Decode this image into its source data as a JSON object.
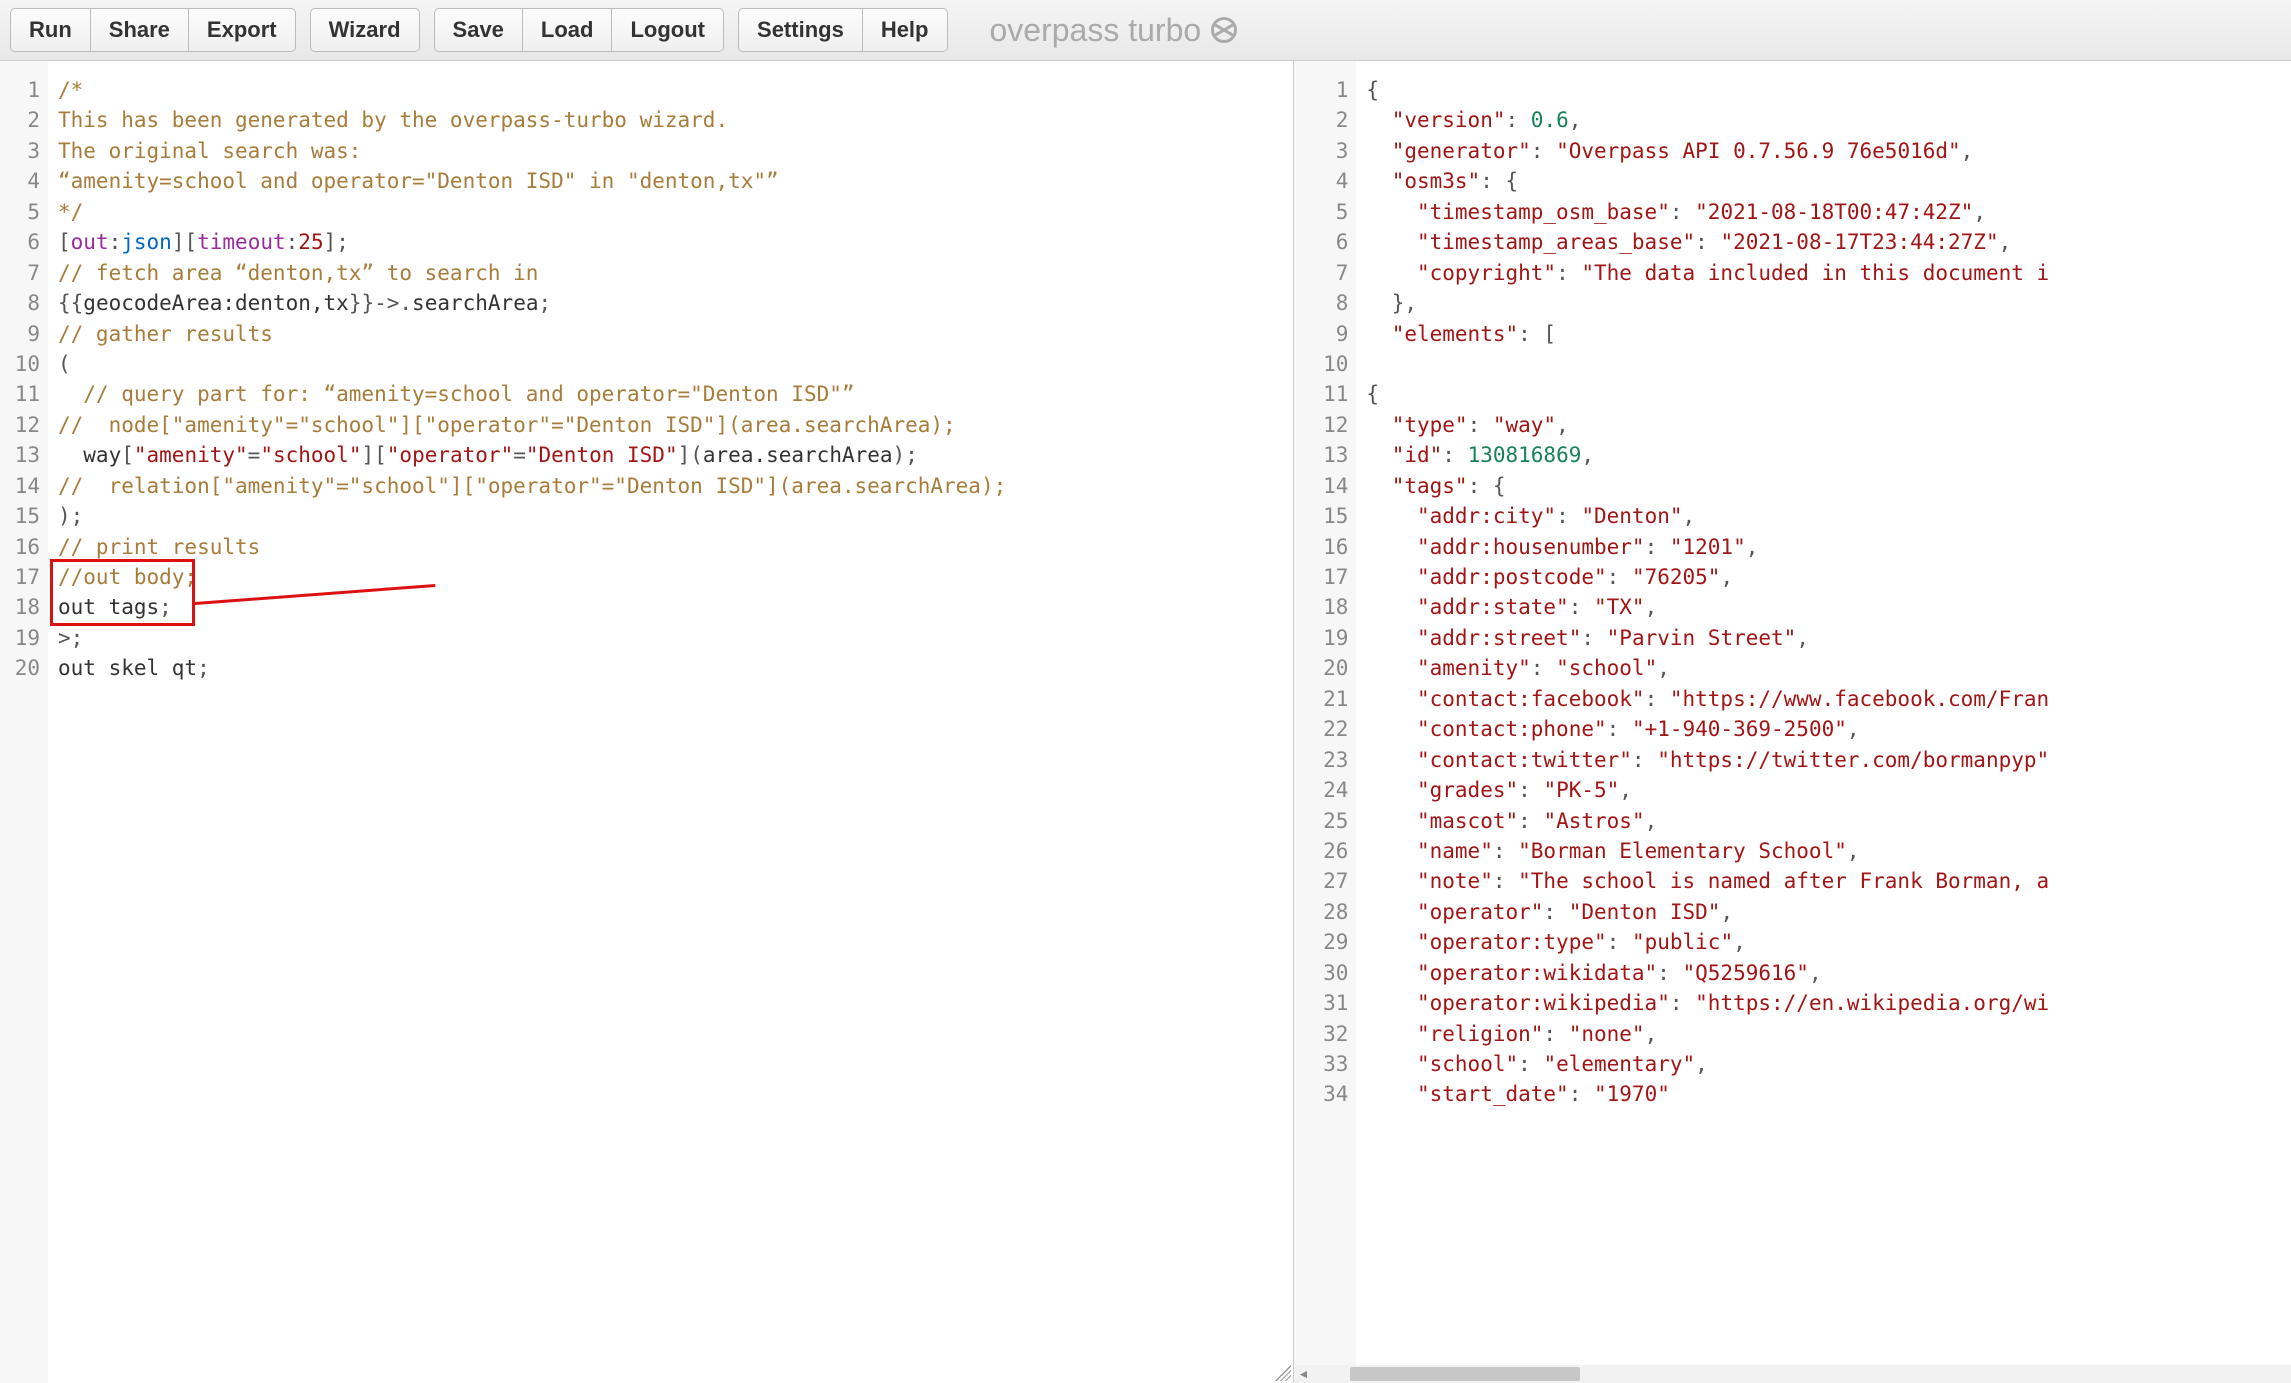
{
  "toolbar": {
    "groups": [
      [
        "Run",
        "Share",
        "Export"
      ],
      [
        "Wizard"
      ],
      [
        "Save",
        "Load",
        "Logout"
      ],
      [
        "Settings",
        "Help"
      ]
    ]
  },
  "brand": {
    "text": "overpass turbo"
  },
  "left_editor": {
    "lines": [
      [
        {
          "cls": "tok-comment",
          "t": "/*"
        }
      ],
      [
        {
          "cls": "tok-comment",
          "t": "This has been generated by the overpass-turbo wizard."
        }
      ],
      [
        {
          "cls": "tok-comment",
          "t": "The original search was:"
        }
      ],
      [
        {
          "cls": "tok-comment",
          "t": "“amenity=school and operator=\"Denton ISD\" in \"denton,tx\"”"
        }
      ],
      [
        {
          "cls": "tok-comment",
          "t": "*/"
        }
      ],
      [
        {
          "cls": "tok-punct",
          "t": "["
        },
        {
          "cls": "tok-kw",
          "t": "out"
        },
        {
          "cls": "tok-punct",
          "t": ":"
        },
        {
          "cls": "tok-var",
          "t": "json"
        },
        {
          "cls": "tok-punct",
          "t": "]["
        },
        {
          "cls": "tok-kw",
          "t": "timeout"
        },
        {
          "cls": "tok-punct",
          "t": ":"
        },
        {
          "cls": "tok-num",
          "t": "25"
        },
        {
          "cls": "tok-punct",
          "t": "];"
        }
      ],
      [
        {
          "cls": "tok-comment",
          "t": "// fetch area “denton,tx” to search in"
        }
      ],
      [
        {
          "cls": "tok-brace",
          "t": "{{"
        },
        {
          "cls": "tok-ident",
          "t": "geocodeArea:denton,tx"
        },
        {
          "cls": "tok-brace",
          "t": "}}"
        },
        {
          "cls": "tok-op",
          "t": "->."
        },
        {
          "cls": "tok-ident",
          "t": "searchArea"
        },
        {
          "cls": "tok-punct",
          "t": ";"
        }
      ],
      [
        {
          "cls": "tok-comment",
          "t": "// gather results"
        }
      ],
      [
        {
          "cls": "tok-punct",
          "t": "("
        }
      ],
      [
        {
          "cls": "tok-comment",
          "t": "  // query part for: “amenity=school and operator=\"Denton ISD\"”"
        }
      ],
      [
        {
          "cls": "tok-comment",
          "t": "//  node[\"amenity\"=\"school\"][\"operator\"=\"Denton ISD\"](area.searchArea);"
        }
      ],
      [
        {
          "cls": "tok-ident",
          "t": "  way"
        },
        {
          "cls": "tok-punct",
          "t": "["
        },
        {
          "cls": "tok-str",
          "t": "\"amenity\""
        },
        {
          "cls": "tok-op",
          "t": "="
        },
        {
          "cls": "tok-str",
          "t": "\"school\""
        },
        {
          "cls": "tok-punct",
          "t": "]["
        },
        {
          "cls": "tok-str",
          "t": "\"operator\""
        },
        {
          "cls": "tok-op",
          "t": "="
        },
        {
          "cls": "tok-str",
          "t": "\"Denton ISD\""
        },
        {
          "cls": "tok-punct",
          "t": "]("
        },
        {
          "cls": "tok-ident",
          "t": "area.searchArea"
        },
        {
          "cls": "tok-punct",
          "t": ");"
        }
      ],
      [
        {
          "cls": "tok-comment",
          "t": "//  relation[\"amenity\"=\"school\"][\"operator\"=\"Denton ISD\"](area.searchArea);"
        }
      ],
      [
        {
          "cls": "tok-punct",
          "t": ");"
        }
      ],
      [
        {
          "cls": "tok-comment",
          "t": "// print results"
        }
      ],
      [
        {
          "cls": "tok-comment",
          "t": "//out body;"
        }
      ],
      [
        {
          "cls": "tok-ident",
          "t": "out tags"
        },
        {
          "cls": "tok-punct",
          "t": ";"
        }
      ],
      [
        {
          "cls": "tok-op",
          "t": ">"
        },
        {
          "cls": "tok-punct",
          "t": ";"
        }
      ],
      [
        {
          "cls": "tok-ident",
          "t": "out skel qt"
        },
        {
          "cls": "tok-punct",
          "t": ";"
        }
      ]
    ],
    "annotation": {
      "box_lines": [
        17,
        18
      ]
    }
  },
  "right_editor": {
    "lines": [
      [
        {
          "cls": "tok-json-punct",
          "t": "{"
        }
      ],
      [
        {
          "cls": "tok-json-punct",
          "t": "  "
        },
        {
          "cls": "tok-json-key",
          "t": "\"version\""
        },
        {
          "cls": "tok-json-punct",
          "t": ": "
        },
        {
          "cls": "tok-json-num",
          "t": "0.6"
        },
        {
          "cls": "tok-json-punct",
          "t": ","
        }
      ],
      [
        {
          "cls": "tok-json-punct",
          "t": "  "
        },
        {
          "cls": "tok-json-key",
          "t": "\"generator\""
        },
        {
          "cls": "tok-json-punct",
          "t": ": "
        },
        {
          "cls": "tok-json-str",
          "t": "\"Overpass API 0.7.56.9 76e5016d\""
        },
        {
          "cls": "tok-json-punct",
          "t": ","
        }
      ],
      [
        {
          "cls": "tok-json-punct",
          "t": "  "
        },
        {
          "cls": "tok-json-key",
          "t": "\"osm3s\""
        },
        {
          "cls": "tok-json-punct",
          "t": ": {"
        }
      ],
      [
        {
          "cls": "tok-json-punct",
          "t": "    "
        },
        {
          "cls": "tok-json-key",
          "t": "\"timestamp_osm_base\""
        },
        {
          "cls": "tok-json-punct",
          "t": ": "
        },
        {
          "cls": "tok-json-str",
          "t": "\"2021-08-18T00:47:42Z\""
        },
        {
          "cls": "tok-json-punct",
          "t": ","
        }
      ],
      [
        {
          "cls": "tok-json-punct",
          "t": "    "
        },
        {
          "cls": "tok-json-key",
          "t": "\"timestamp_areas_base\""
        },
        {
          "cls": "tok-json-punct",
          "t": ": "
        },
        {
          "cls": "tok-json-str",
          "t": "\"2021-08-17T23:44:27Z\""
        },
        {
          "cls": "tok-json-punct",
          "t": ","
        }
      ],
      [
        {
          "cls": "tok-json-punct",
          "t": "    "
        },
        {
          "cls": "tok-json-key",
          "t": "\"copyright\""
        },
        {
          "cls": "tok-json-punct",
          "t": ": "
        },
        {
          "cls": "tok-json-str",
          "t": "\"The data included in this document i"
        }
      ],
      [
        {
          "cls": "tok-json-punct",
          "t": "  },"
        }
      ],
      [
        {
          "cls": "tok-json-punct",
          "t": "  "
        },
        {
          "cls": "tok-json-key",
          "t": "\"elements\""
        },
        {
          "cls": "tok-json-punct",
          "t": ": ["
        }
      ],
      [
        {
          "cls": "tok-json-punct",
          "t": ""
        }
      ],
      [
        {
          "cls": "tok-json-punct",
          "t": "{"
        }
      ],
      [
        {
          "cls": "tok-json-punct",
          "t": "  "
        },
        {
          "cls": "tok-json-key",
          "t": "\"type\""
        },
        {
          "cls": "tok-json-punct",
          "t": ": "
        },
        {
          "cls": "tok-json-str",
          "t": "\"way\""
        },
        {
          "cls": "tok-json-punct",
          "t": ","
        }
      ],
      [
        {
          "cls": "tok-json-punct",
          "t": "  "
        },
        {
          "cls": "tok-json-key",
          "t": "\"id\""
        },
        {
          "cls": "tok-json-punct",
          "t": ": "
        },
        {
          "cls": "tok-json-num",
          "t": "130816869"
        },
        {
          "cls": "tok-json-punct",
          "t": ","
        }
      ],
      [
        {
          "cls": "tok-json-punct",
          "t": "  "
        },
        {
          "cls": "tok-json-key",
          "t": "\"tags\""
        },
        {
          "cls": "tok-json-punct",
          "t": ": {"
        }
      ],
      [
        {
          "cls": "tok-json-punct",
          "t": "    "
        },
        {
          "cls": "tok-json-key",
          "t": "\"addr:city\""
        },
        {
          "cls": "tok-json-punct",
          "t": ": "
        },
        {
          "cls": "tok-json-str",
          "t": "\"Denton\""
        },
        {
          "cls": "tok-json-punct",
          "t": ","
        }
      ],
      [
        {
          "cls": "tok-json-punct",
          "t": "    "
        },
        {
          "cls": "tok-json-key",
          "t": "\"addr:housenumber\""
        },
        {
          "cls": "tok-json-punct",
          "t": ": "
        },
        {
          "cls": "tok-json-str",
          "t": "\"1201\""
        },
        {
          "cls": "tok-json-punct",
          "t": ","
        }
      ],
      [
        {
          "cls": "tok-json-punct",
          "t": "    "
        },
        {
          "cls": "tok-json-key",
          "t": "\"addr:postcode\""
        },
        {
          "cls": "tok-json-punct",
          "t": ": "
        },
        {
          "cls": "tok-json-str",
          "t": "\"76205\""
        },
        {
          "cls": "tok-json-punct",
          "t": ","
        }
      ],
      [
        {
          "cls": "tok-json-punct",
          "t": "    "
        },
        {
          "cls": "tok-json-key",
          "t": "\"addr:state\""
        },
        {
          "cls": "tok-json-punct",
          "t": ": "
        },
        {
          "cls": "tok-json-str",
          "t": "\"TX\""
        },
        {
          "cls": "tok-json-punct",
          "t": ","
        }
      ],
      [
        {
          "cls": "tok-json-punct",
          "t": "    "
        },
        {
          "cls": "tok-json-key",
          "t": "\"addr:street\""
        },
        {
          "cls": "tok-json-punct",
          "t": ": "
        },
        {
          "cls": "tok-json-str",
          "t": "\"Parvin Street\""
        },
        {
          "cls": "tok-json-punct",
          "t": ","
        }
      ],
      [
        {
          "cls": "tok-json-punct",
          "t": "    "
        },
        {
          "cls": "tok-json-key",
          "t": "\"amenity\""
        },
        {
          "cls": "tok-json-punct",
          "t": ": "
        },
        {
          "cls": "tok-json-str",
          "t": "\"school\""
        },
        {
          "cls": "tok-json-punct",
          "t": ","
        }
      ],
      [
        {
          "cls": "tok-json-punct",
          "t": "    "
        },
        {
          "cls": "tok-json-key",
          "t": "\"contact:facebook\""
        },
        {
          "cls": "tok-json-punct",
          "t": ": "
        },
        {
          "cls": "tok-json-str",
          "t": "\"https://www.facebook.com/Fran"
        }
      ],
      [
        {
          "cls": "tok-json-punct",
          "t": "    "
        },
        {
          "cls": "tok-json-key",
          "t": "\"contact:phone\""
        },
        {
          "cls": "tok-json-punct",
          "t": ": "
        },
        {
          "cls": "tok-json-str",
          "t": "\"+1-940-369-2500\""
        },
        {
          "cls": "tok-json-punct",
          "t": ","
        }
      ],
      [
        {
          "cls": "tok-json-punct",
          "t": "    "
        },
        {
          "cls": "tok-json-key",
          "t": "\"contact:twitter\""
        },
        {
          "cls": "tok-json-punct",
          "t": ": "
        },
        {
          "cls": "tok-json-str",
          "t": "\"https://twitter.com/bormanpyp\""
        }
      ],
      [
        {
          "cls": "tok-json-punct",
          "t": "    "
        },
        {
          "cls": "tok-json-key",
          "t": "\"grades\""
        },
        {
          "cls": "tok-json-punct",
          "t": ": "
        },
        {
          "cls": "tok-json-str",
          "t": "\"PK-5\""
        },
        {
          "cls": "tok-json-punct",
          "t": ","
        }
      ],
      [
        {
          "cls": "tok-json-punct",
          "t": "    "
        },
        {
          "cls": "tok-json-key",
          "t": "\"mascot\""
        },
        {
          "cls": "tok-json-punct",
          "t": ": "
        },
        {
          "cls": "tok-json-str",
          "t": "\"Astros\""
        },
        {
          "cls": "tok-json-punct",
          "t": ","
        }
      ],
      [
        {
          "cls": "tok-json-punct",
          "t": "    "
        },
        {
          "cls": "tok-json-key",
          "t": "\"name\""
        },
        {
          "cls": "tok-json-punct",
          "t": ": "
        },
        {
          "cls": "tok-json-str",
          "t": "\"Borman Elementary School\""
        },
        {
          "cls": "tok-json-punct",
          "t": ","
        }
      ],
      [
        {
          "cls": "tok-json-punct",
          "t": "    "
        },
        {
          "cls": "tok-json-key",
          "t": "\"note\""
        },
        {
          "cls": "tok-json-punct",
          "t": ": "
        },
        {
          "cls": "tok-json-str",
          "t": "\"The school is named after Frank Borman, a"
        }
      ],
      [
        {
          "cls": "tok-json-punct",
          "t": "    "
        },
        {
          "cls": "tok-json-key",
          "t": "\"operator\""
        },
        {
          "cls": "tok-json-punct",
          "t": ": "
        },
        {
          "cls": "tok-json-str",
          "t": "\"Denton ISD\""
        },
        {
          "cls": "tok-json-punct",
          "t": ","
        }
      ],
      [
        {
          "cls": "tok-json-punct",
          "t": "    "
        },
        {
          "cls": "tok-json-key",
          "t": "\"operator:type\""
        },
        {
          "cls": "tok-json-punct",
          "t": ": "
        },
        {
          "cls": "tok-json-str",
          "t": "\"public\""
        },
        {
          "cls": "tok-json-punct",
          "t": ","
        }
      ],
      [
        {
          "cls": "tok-json-punct",
          "t": "    "
        },
        {
          "cls": "tok-json-key",
          "t": "\"operator:wikidata\""
        },
        {
          "cls": "tok-json-punct",
          "t": ": "
        },
        {
          "cls": "tok-json-str",
          "t": "\"Q5259616\""
        },
        {
          "cls": "tok-json-punct",
          "t": ","
        }
      ],
      [
        {
          "cls": "tok-json-punct",
          "t": "    "
        },
        {
          "cls": "tok-json-key",
          "t": "\"operator:wikipedia\""
        },
        {
          "cls": "tok-json-punct",
          "t": ": "
        },
        {
          "cls": "tok-json-str",
          "t": "\"https://en.wikipedia.org/wi"
        }
      ],
      [
        {
          "cls": "tok-json-punct",
          "t": "    "
        },
        {
          "cls": "tok-json-key",
          "t": "\"religion\""
        },
        {
          "cls": "tok-json-punct",
          "t": ": "
        },
        {
          "cls": "tok-json-str",
          "t": "\"none\""
        },
        {
          "cls": "tok-json-punct",
          "t": ","
        }
      ],
      [
        {
          "cls": "tok-json-punct",
          "t": "    "
        },
        {
          "cls": "tok-json-key",
          "t": "\"school\""
        },
        {
          "cls": "tok-json-punct",
          "t": ": "
        },
        {
          "cls": "tok-json-str",
          "t": "\"elementary\""
        },
        {
          "cls": "tok-json-punct",
          "t": ","
        }
      ],
      [
        {
          "cls": "tok-json-punct",
          "t": "    "
        },
        {
          "cls": "tok-json-key",
          "t": "\"start_date\""
        },
        {
          "cls": "tok-json-punct",
          "t": ": "
        },
        {
          "cls": "tok-json-str",
          "t": "\"1970\""
        }
      ]
    ]
  }
}
